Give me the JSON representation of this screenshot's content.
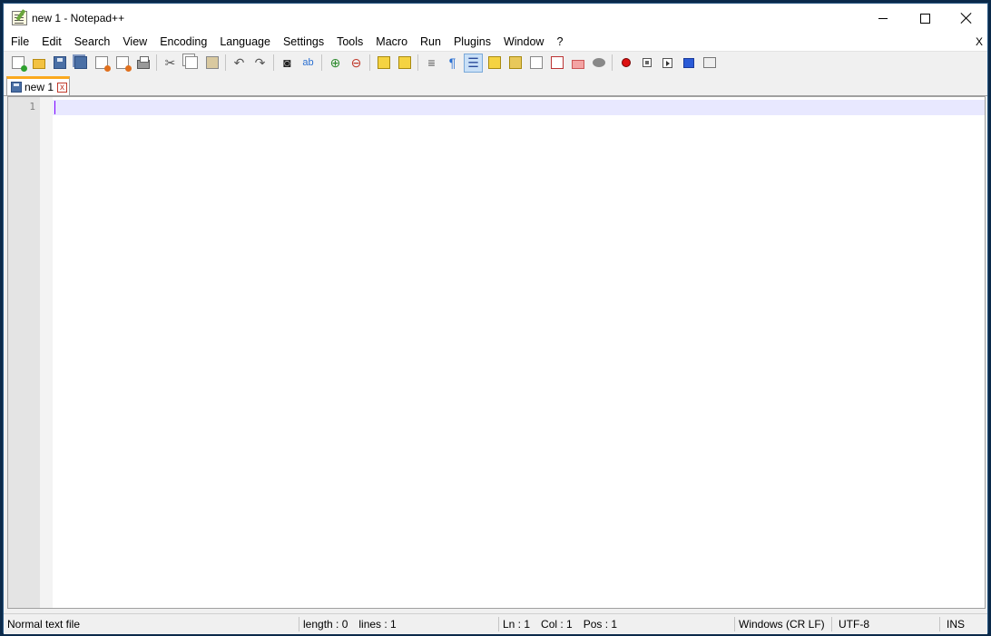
{
  "window": {
    "title": "new 1 - Notepad++"
  },
  "menu": {
    "items": [
      "File",
      "Edit",
      "Search",
      "View",
      "Encoding",
      "Language",
      "Settings",
      "Tools",
      "Macro",
      "Run",
      "Plugins",
      "Window",
      "?"
    ],
    "close_label": "X"
  },
  "toolbar": {
    "buttons": [
      "new-file-icon",
      "open-file-icon",
      "save-icon",
      "save-all-icon",
      "close-icon",
      "close-all-icon",
      "print-icon",
      "cut-icon",
      "copy-icon",
      "paste-icon",
      "undo-icon",
      "redo-icon",
      "find-icon",
      "replace-icon",
      "zoom-in-icon",
      "zoom-out-icon",
      "sync-vertical-icon",
      "sync-horizontal-icon",
      "word-wrap-icon",
      "show-all-chars-icon",
      "indent-guide-icon",
      "user-defined-language-icon",
      "document-map-icon",
      "document-list-icon",
      "function-list-icon",
      "folder-as-workspace-icon",
      "monitoring-icon",
      "record-macro-icon",
      "stop-recording-icon",
      "playback-macro-icon",
      "run-macro-multiple-icon",
      "save-macro-icon"
    ],
    "active_button": "indent-guide-icon"
  },
  "tabs": [
    {
      "label": "new 1",
      "close_label": "x"
    }
  ],
  "editor": {
    "line_numbers": [
      "1"
    ],
    "content": ""
  },
  "status": {
    "file_type": "Normal text file",
    "length": "length : 0",
    "lines": "lines : 1",
    "ln": "Ln : 1",
    "col": "Col : 1",
    "pos": "Pos : 1",
    "eol": "Windows (CR LF)",
    "encoding": "UTF-8",
    "mode": "INS"
  }
}
